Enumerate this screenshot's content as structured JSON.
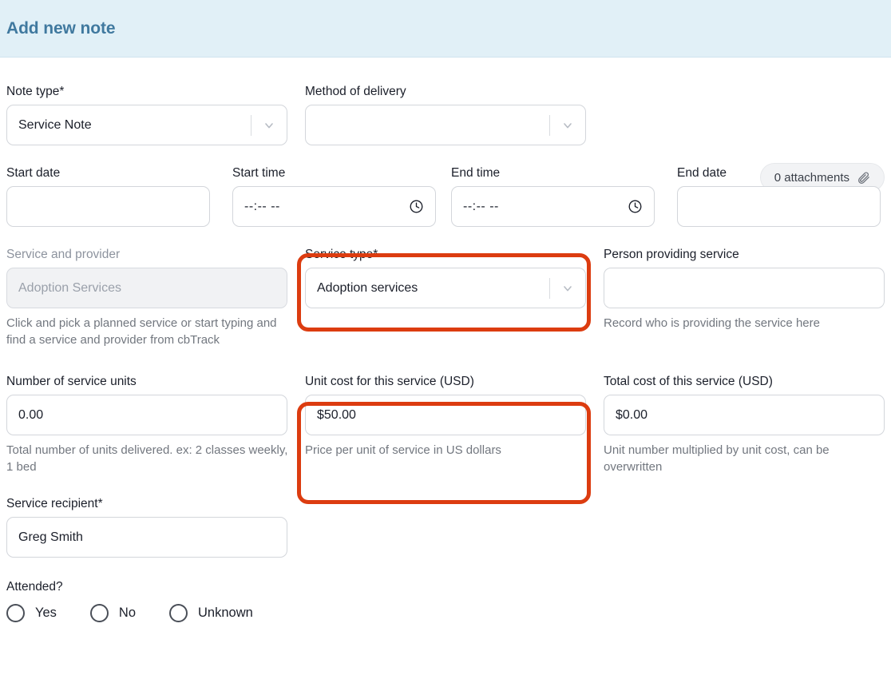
{
  "header": {
    "title": "Add new note",
    "bg_color": "#e1f0f7",
    "title_color": "#40799f"
  },
  "attachments": {
    "label": "0 attachments",
    "icon": "paperclip-icon"
  },
  "highlight_color": "#dc3c10",
  "fields": {
    "note_type": {
      "label": "Note type",
      "required": "*",
      "value": "Service Note",
      "icon": "chevron-down-icon"
    },
    "method_of_delivery": {
      "label": "Method of delivery",
      "value": "",
      "icon": "chevron-down-icon"
    },
    "start_date": {
      "label": "Start date",
      "value": ""
    },
    "start_time": {
      "label": "Start time",
      "placeholder": "--:-- --",
      "icon": "clock-icon"
    },
    "end_time": {
      "label": "End time",
      "placeholder": "--:-- --",
      "icon": "clock-icon"
    },
    "end_date": {
      "label": "End date",
      "value": ""
    },
    "service_and_provider": {
      "label": "Service and provider",
      "placeholder": "Adoption Services",
      "help": "Click and pick a planned service or start typing and find a service and provider from cbTrack",
      "disabled": true
    },
    "service_type": {
      "label": "Service type",
      "required": "*",
      "value": "Adoption services",
      "icon": "chevron-down-icon",
      "highlighted": true
    },
    "person_providing_service": {
      "label": "Person providing service",
      "value": "",
      "help": "Record who is providing the service here"
    },
    "number_of_service_units": {
      "label": "Number of service units",
      "value": "0.00",
      "help": "Total number of units delivered. ex: 2 classes weekly, 1 bed"
    },
    "unit_cost": {
      "label": "Unit cost for this service (USD)",
      "value": "$50.00",
      "help": "Price per unit of service in US dollars",
      "highlighted": true
    },
    "total_cost": {
      "label": "Total cost of this service (USD)",
      "value": "$0.00",
      "help": "Unit number multiplied by unit cost, can be overwritten"
    },
    "service_recipient": {
      "label": "Service recipient",
      "required": "*",
      "value": "Greg Smith"
    },
    "attended": {
      "label": "Attended?",
      "options": [
        {
          "label": "Yes",
          "selected": false
        },
        {
          "label": "No",
          "selected": false
        },
        {
          "label": "Unknown",
          "selected": false
        }
      ]
    }
  }
}
